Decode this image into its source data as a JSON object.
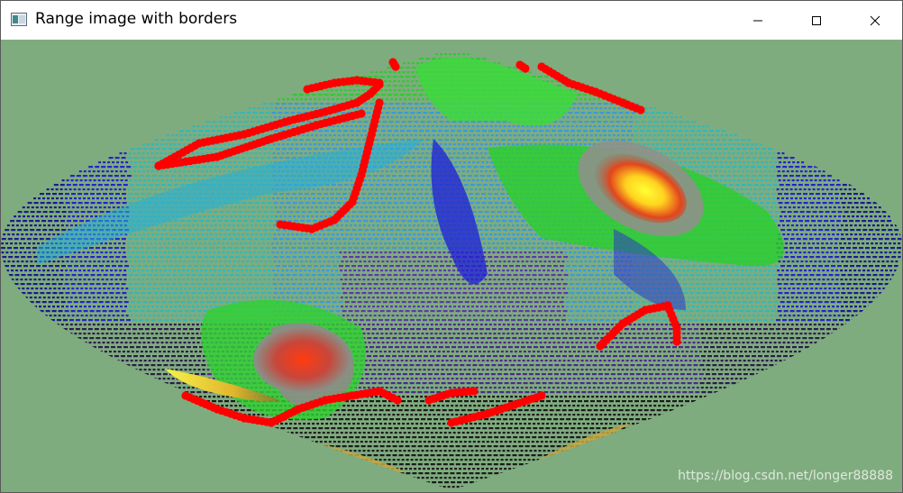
{
  "window": {
    "title": "Range image with borders",
    "icon": "app-icon",
    "controls": [
      "minimize-icon",
      "maximize-icon",
      "close-icon"
    ]
  },
  "viewer": {
    "background_color": "#7fac7f",
    "border_point_color": "#ff0000",
    "watermark": "https://blog.csdn.net/longer88888"
  }
}
